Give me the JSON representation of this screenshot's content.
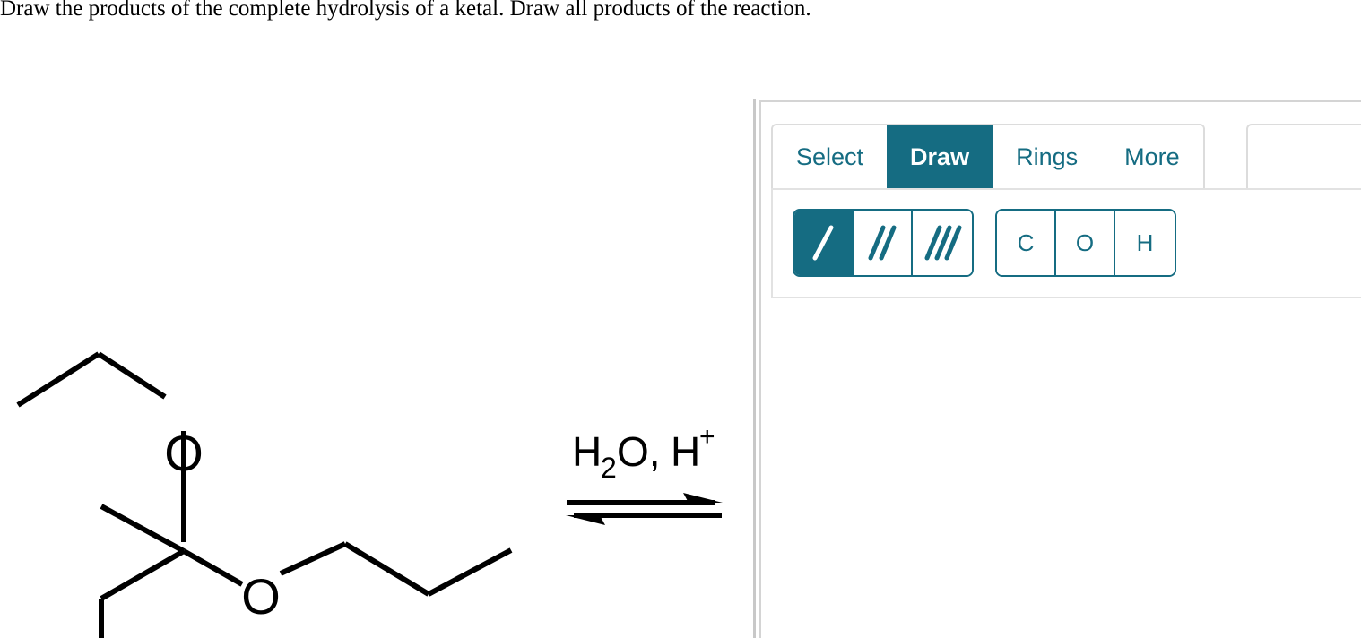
{
  "prompt": {
    "text": "Draw the products of the complete hydrolysis of a ketal. Draw all products of the reaction."
  },
  "reaction": {
    "conditions": "H₂O, H⁺",
    "arrow_type": "equilibrium",
    "reactant_labels": {
      "oxygen_top": "O",
      "oxygen_bottom": "O"
    },
    "reactant_name": "ketal"
  },
  "editor": {
    "tabs": [
      {
        "label": "Select",
        "active": false
      },
      {
        "label": "Draw",
        "active": true
      },
      {
        "label": "Rings",
        "active": false
      },
      {
        "label": "More",
        "active": false
      }
    ],
    "bond_tools": [
      {
        "name": "single-bond",
        "order": 1,
        "selected": true
      },
      {
        "name": "double-bond",
        "order": 2,
        "selected": false
      },
      {
        "name": "triple-bond",
        "order": 3,
        "selected": false
      }
    ],
    "atom_tools": [
      {
        "label": "C",
        "selected": false
      },
      {
        "label": "O",
        "selected": false
      },
      {
        "label": "H",
        "selected": false
      }
    ]
  },
  "colors": {
    "accent": "#156c82",
    "panel_border": "#d4d4d4",
    "tab_border": "#dcdcdc",
    "divider": "#c8c8c8",
    "structure": "#000000",
    "background": "#ffffff"
  }
}
